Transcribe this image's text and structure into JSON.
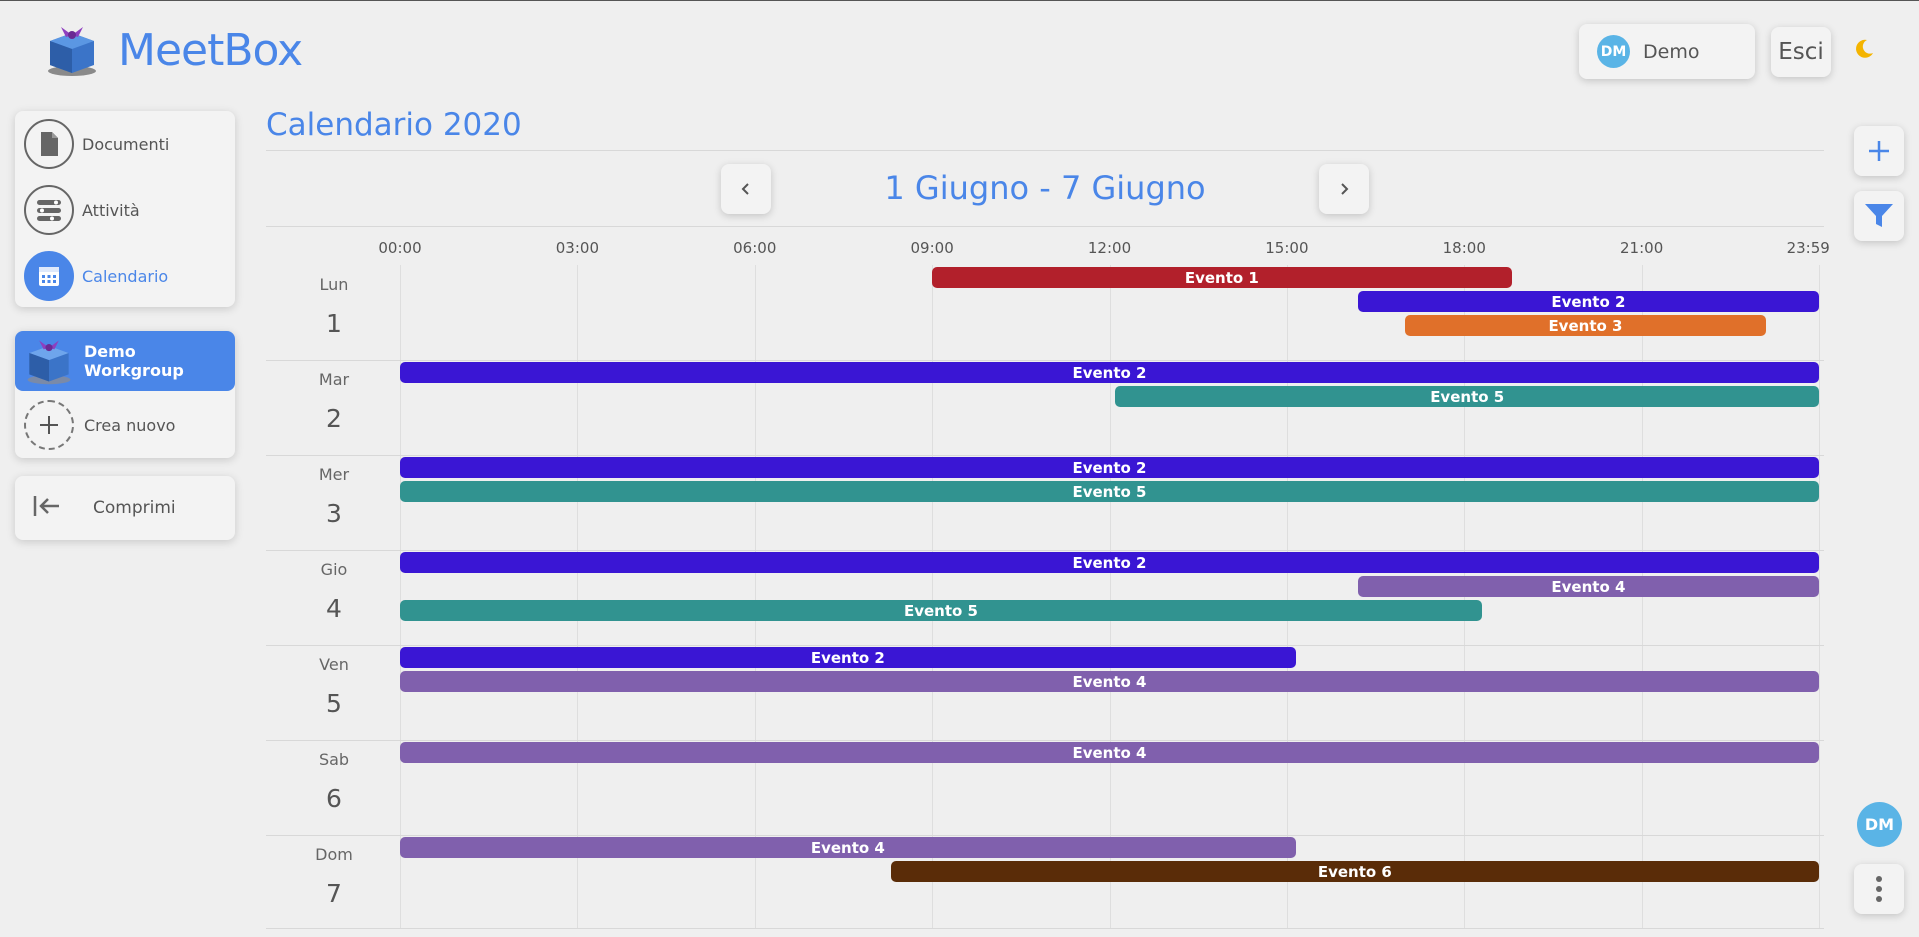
{
  "app": {
    "name": "MeetBox"
  },
  "user": {
    "initials": "DM",
    "name": "Demo"
  },
  "header": {
    "logout_label": "Esci",
    "theme_icon": "moon-icon"
  },
  "sidebar": {
    "nav": [
      {
        "label": "Documenti",
        "icon": "document-icon"
      },
      {
        "label": "Attività",
        "icon": "tasks-icon"
      },
      {
        "label": "Calendario",
        "icon": "calendar-icon",
        "active": true
      }
    ],
    "workgroups": [
      {
        "label": "Demo Workgroup",
        "active": true
      },
      {
        "label": "Crea nuovo",
        "icon": "plus-icon"
      }
    ],
    "collapse_label": "Comprimi"
  },
  "calendar": {
    "title": "Calendario 2020",
    "week_label": "1 Giugno - 7 Giugno",
    "prev_icon": "chevron-left-icon",
    "next_icon": "chevron-right-icon",
    "hours": [
      "00:00",
      "03:00",
      "06:00",
      "09:00",
      "12:00",
      "15:00",
      "18:00",
      "21:00",
      "23:59"
    ],
    "days": [
      {
        "name": "Lun",
        "num": "1",
        "events": [
          {
            "label": "Evento 1",
            "start": 9.0,
            "end": 18.8,
            "color": "#b2202b"
          },
          {
            "label": "Evento 2",
            "start": 16.2,
            "end": 24.0,
            "color": "#3a16d4"
          },
          {
            "label": "Evento 3",
            "start": 17.0,
            "end": 23.1,
            "color": "#e0702a"
          }
        ]
      },
      {
        "name": "Mar",
        "num": "2",
        "events": [
          {
            "label": "Evento 2",
            "start": 0.0,
            "end": 24.0,
            "color": "#3a16d4"
          },
          {
            "label": "Evento 5",
            "start": 12.1,
            "end": 24.0,
            "color": "#319390"
          }
        ]
      },
      {
        "name": "Mer",
        "num": "3",
        "events": [
          {
            "label": "Evento 2",
            "start": 0.0,
            "end": 24.0,
            "color": "#3a16d4"
          },
          {
            "label": "Evento 5",
            "start": 0.0,
            "end": 24.0,
            "color": "#319390"
          }
        ]
      },
      {
        "name": "Gio",
        "num": "4",
        "events": [
          {
            "label": "Evento 2",
            "start": 0.0,
            "end": 24.0,
            "color": "#3a16d4"
          },
          {
            "label": "Evento 4",
            "start": 16.2,
            "end": 24.0,
            "color": "#8060ad"
          },
          {
            "label": "Evento 5",
            "start": 0.0,
            "end": 18.3,
            "color": "#319390"
          }
        ]
      },
      {
        "name": "Ven",
        "num": "5",
        "events": [
          {
            "label": "Evento 2",
            "start": 0.0,
            "end": 15.15,
            "color": "#3a16d4"
          },
          {
            "label": "Evento 4",
            "start": 0.0,
            "end": 24.0,
            "color": "#8060ad"
          }
        ]
      },
      {
        "name": "Sab",
        "num": "6",
        "events": [
          {
            "label": "Evento 4",
            "start": 0.0,
            "end": 24.0,
            "color": "#8060ad"
          }
        ]
      },
      {
        "name": "Dom",
        "num": "7",
        "events": [
          {
            "label": "Evento 4",
            "start": 0.0,
            "end": 15.15,
            "color": "#8060ad"
          },
          {
            "label": "Evento 6",
            "start": 8.3,
            "end": 24.0,
            "color": "#5a2c08"
          }
        ]
      }
    ]
  },
  "rail": {
    "add_icon": "plus-icon",
    "filter_icon": "filter-icon",
    "more_icon": "more-vertical-icon",
    "avatar_initials": "DM"
  },
  "colors": {
    "accent": "#4a86e8",
    "avatar": "#5ab4e6",
    "background": "#efefef"
  }
}
